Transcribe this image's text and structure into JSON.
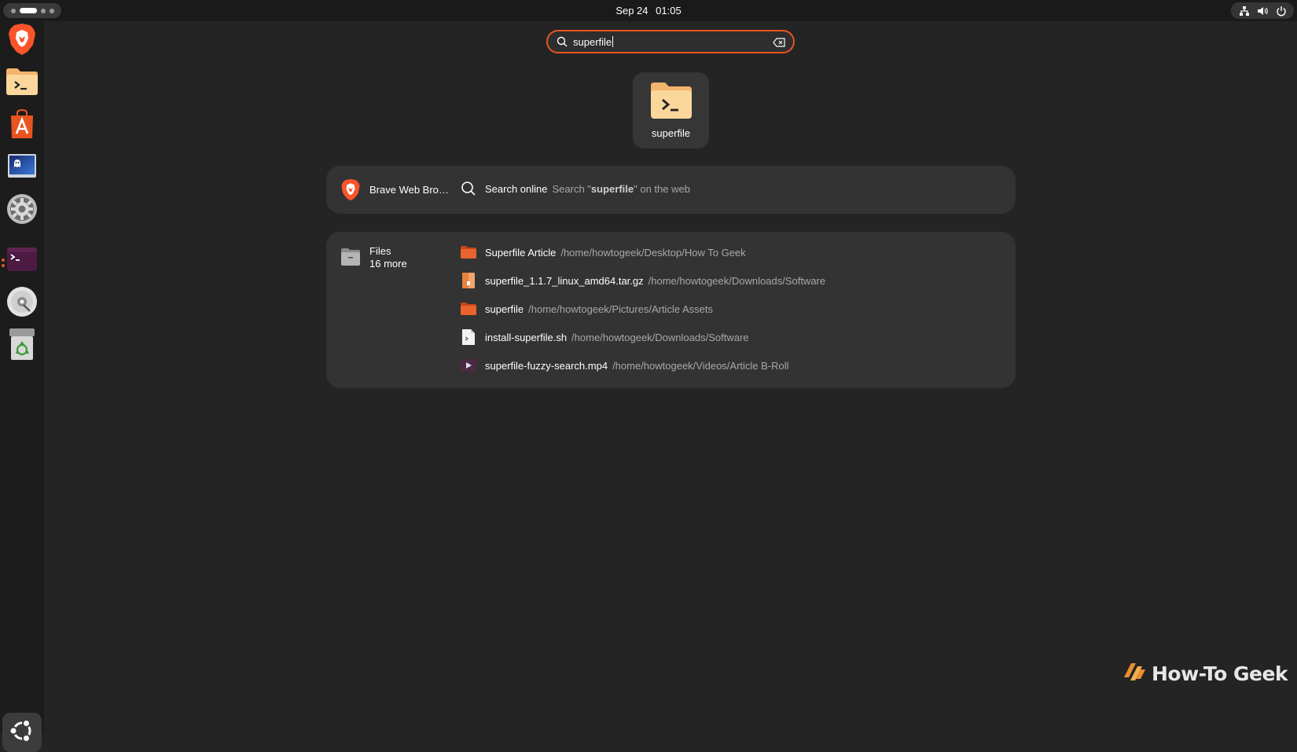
{
  "topbar": {
    "date": "Sep 24",
    "time": "01:05"
  },
  "dock": {
    "items": [
      {
        "name": "Brave Web Browser",
        "icon": "brave-lion-icon",
        "running": false
      },
      {
        "name": "superfile",
        "icon": "folder-terminal-icon",
        "running": false
      },
      {
        "name": "App Center",
        "icon": "app-center-icon",
        "running": false
      },
      {
        "name": "Virtual Machine",
        "icon": "virtual-machine-icon",
        "running": false
      },
      {
        "name": "Settings",
        "icon": "settings-gear-icon",
        "running": false
      },
      {
        "name": "Terminal",
        "icon": "terminal-icon",
        "running": true
      },
      {
        "name": "Disc",
        "icon": "optical-disc-icon",
        "running": false
      },
      {
        "name": "Trash",
        "icon": "trash-icon",
        "running": false
      }
    ],
    "apps_button_icon": "show-apps-icon"
  },
  "search": {
    "value": "superfile"
  },
  "app_result": {
    "name": "superfile"
  },
  "web_provider": {
    "label": "Brave Web Bro…",
    "title": "Search online",
    "desc_prefix": "Search \"",
    "query": "superfile",
    "desc_suffix": "\" on the web"
  },
  "files_provider": {
    "label": "Files",
    "more": "16 more",
    "results": [
      {
        "name": "Superfile Article",
        "path": "/home/howtogeek/Desktop/How To Geek",
        "icon": "folder-icon"
      },
      {
        "name": "superfile_1.1.7_linux_amd64.tar.gz",
        "path": "/home/howtogeek/Downloads/Software",
        "icon": "archive-icon"
      },
      {
        "name": "superfile",
        "path": "/home/howtogeek/Pictures/Article Assets",
        "icon": "folder-icon"
      },
      {
        "name": "install-superfile.sh",
        "path": "/home/howtogeek/Downloads/Software",
        "icon": "script-file-icon"
      },
      {
        "name": "superfile-fuzzy-search.mp4",
        "path": "/home/howtogeek/Videos/Article B-Roll",
        "icon": "video-file-icon"
      }
    ]
  },
  "watermark": {
    "text": "How-To Geek"
  },
  "colors": {
    "accent": "#e95420",
    "background": "#242424",
    "panel": "#333333",
    "folder_orange": "#e8642c"
  }
}
